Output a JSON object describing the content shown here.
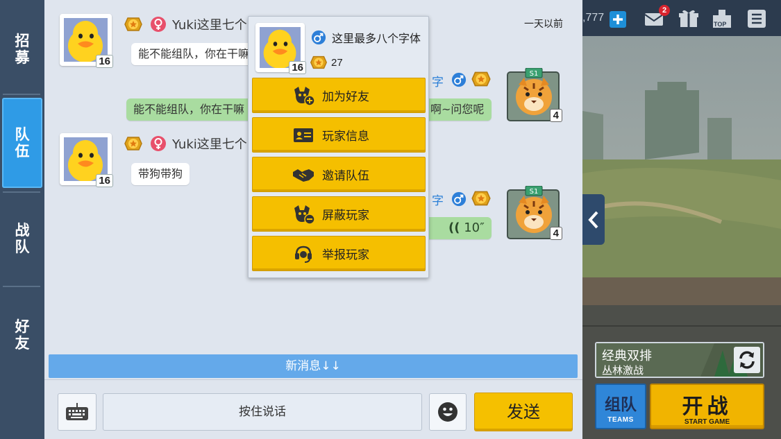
{
  "nav": {
    "items": [
      {
        "label": "招募"
      },
      {
        "label": "队伍"
      },
      {
        "label": "战队"
      },
      {
        "label": "好友"
      }
    ],
    "active_index": 1
  },
  "chat": {
    "timestamp": "一天以前",
    "messages": [
      {
        "level": "16",
        "name": "Yuki这里七个",
        "text": "能不能组队，你在干嘛"
      },
      {
        "text": "能不能组队，你在干嘛",
        "text_right": "啊~问您呢",
        "name_fragment": "字",
        "level": "4"
      },
      {
        "level": "16",
        "name": "Yuki这里七个",
        "text": "带狗带狗"
      },
      {
        "voice": "10″",
        "name_fragment": "字",
        "level": "4"
      }
    ],
    "new_messages_label": "新消息↓↓"
  },
  "input": {
    "hold_to_talk": "按住说话",
    "send": "发送"
  },
  "popup": {
    "name": "这里最多八个字体",
    "level": "16",
    "rank_value": "27",
    "actions": [
      {
        "label": "加为好友",
        "icon": "add-friend-icon"
      },
      {
        "label": "玩家信息",
        "icon": "id-card-icon"
      },
      {
        "label": "邀请队伍",
        "icon": "handshake-icon"
      },
      {
        "label": "屏蔽玩家",
        "icon": "block-player-icon"
      },
      {
        "label": "举报玩家",
        "icon": "headset-report-icon"
      }
    ]
  },
  "topbar": {
    "coins": ",777",
    "mail_badge": "2",
    "top_label": "TOP"
  },
  "game": {
    "mode_title": "经典双排",
    "mode_subtitle": "丛林激战",
    "team_label": "组队",
    "team_sub": "TEAMS",
    "start_label": "开战",
    "start_sub": "START GAME"
  },
  "colors": {
    "accent_blue": "#2f9be6",
    "button_yellow": "#f5bf00",
    "chat_bg": "#dfe5ee",
    "nav_bg": "#3a4e66"
  }
}
